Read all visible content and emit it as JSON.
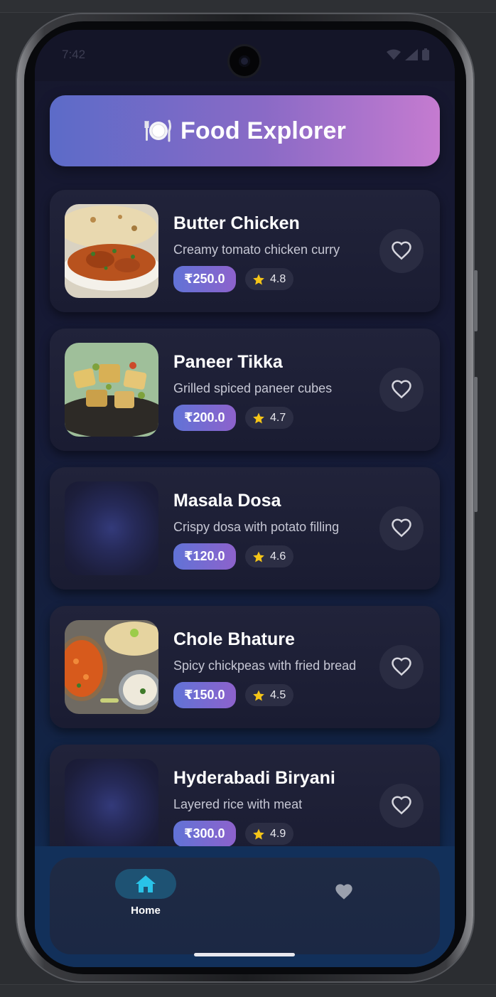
{
  "status_bar": {
    "time": "7:42"
  },
  "header": {
    "icon": "plate-cutlery-icon",
    "title": "Food Explorer"
  },
  "foods": [
    {
      "name": "Butter Chicken",
      "description": "Creamy tomato chicken curry",
      "price": "₹250.0",
      "rating": "4.8",
      "image": "butter-chicken-photo"
    },
    {
      "name": "Paneer Tikka",
      "description": "Grilled spiced paneer cubes",
      "price": "₹200.0",
      "rating": "4.7",
      "image": "paneer-tikka-photo"
    },
    {
      "name": "Masala Dosa",
      "description": "Crispy dosa with potato filling",
      "price": "₹120.0",
      "rating": "4.6",
      "image": "placeholder"
    },
    {
      "name": "Chole Bhature",
      "description": "Spicy chickpeas with fried bread",
      "price": "₹150.0",
      "rating": "4.5",
      "image": "chole-bhature-photo"
    },
    {
      "name": "Hyderabadi Biryani",
      "description": "Layered rice with meat",
      "price": "₹300.0",
      "rating": "4.9",
      "image": "placeholder"
    }
  ],
  "bottom_nav": {
    "items": [
      {
        "label": "Home",
        "icon": "home-icon",
        "active": true
      },
      {
        "label": "",
        "icon": "heart-icon",
        "active": false
      }
    ]
  },
  "colors": {
    "accent_cyan": "#29c3e8",
    "price_gradient_start": "#6173d6",
    "price_gradient_end": "#8d62cc",
    "star": "#f5c518",
    "header_gradient_start": "#5c6bc8",
    "header_gradient_end": "#c57bd0"
  }
}
